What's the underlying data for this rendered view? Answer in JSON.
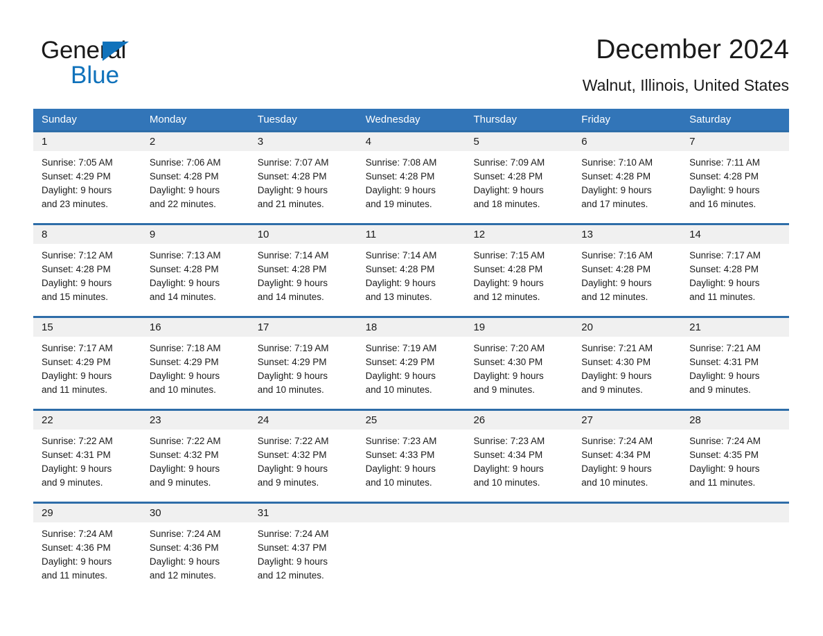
{
  "brand": {
    "name_part1": "General",
    "name_part2": "Blue",
    "triangle_color": "#1072bb",
    "text_color": "#1a1a1a"
  },
  "header": {
    "title": "December 2024",
    "subtitle": "Walnut, Illinois, United States"
  },
  "theme": {
    "header_blue": "#3275b8",
    "separator_blue": "#2e6da8",
    "daynum_band": "#f0f0f0",
    "text": "#1a1a1a",
    "header_text": "#ffffff"
  },
  "weekdays": [
    "Sunday",
    "Monday",
    "Tuesday",
    "Wednesday",
    "Thursday",
    "Friday",
    "Saturday"
  ],
  "weeks": [
    {
      "days": [
        {
          "num": "1",
          "sunrise": "Sunrise: 7:05 AM",
          "sunset": "Sunset: 4:29 PM",
          "daylight1": "Daylight: 9 hours",
          "daylight2": "and 23 minutes."
        },
        {
          "num": "2",
          "sunrise": "Sunrise: 7:06 AM",
          "sunset": "Sunset: 4:28 PM",
          "daylight1": "Daylight: 9 hours",
          "daylight2": "and 22 minutes."
        },
        {
          "num": "3",
          "sunrise": "Sunrise: 7:07 AM",
          "sunset": "Sunset: 4:28 PM",
          "daylight1": "Daylight: 9 hours",
          "daylight2": "and 21 minutes."
        },
        {
          "num": "4",
          "sunrise": "Sunrise: 7:08 AM",
          "sunset": "Sunset: 4:28 PM",
          "daylight1": "Daylight: 9 hours",
          "daylight2": "and 19 minutes."
        },
        {
          "num": "5",
          "sunrise": "Sunrise: 7:09 AM",
          "sunset": "Sunset: 4:28 PM",
          "daylight1": "Daylight: 9 hours",
          "daylight2": "and 18 minutes."
        },
        {
          "num": "6",
          "sunrise": "Sunrise: 7:10 AM",
          "sunset": "Sunset: 4:28 PM",
          "daylight1": "Daylight: 9 hours",
          "daylight2": "and 17 minutes."
        },
        {
          "num": "7",
          "sunrise": "Sunrise: 7:11 AM",
          "sunset": "Sunset: 4:28 PM",
          "daylight1": "Daylight: 9 hours",
          "daylight2": "and 16 minutes."
        }
      ]
    },
    {
      "days": [
        {
          "num": "8",
          "sunrise": "Sunrise: 7:12 AM",
          "sunset": "Sunset: 4:28 PM",
          "daylight1": "Daylight: 9 hours",
          "daylight2": "and 15 minutes."
        },
        {
          "num": "9",
          "sunrise": "Sunrise: 7:13 AM",
          "sunset": "Sunset: 4:28 PM",
          "daylight1": "Daylight: 9 hours",
          "daylight2": "and 14 minutes."
        },
        {
          "num": "10",
          "sunrise": "Sunrise: 7:14 AM",
          "sunset": "Sunset: 4:28 PM",
          "daylight1": "Daylight: 9 hours",
          "daylight2": "and 14 minutes."
        },
        {
          "num": "11",
          "sunrise": "Sunrise: 7:14 AM",
          "sunset": "Sunset: 4:28 PM",
          "daylight1": "Daylight: 9 hours",
          "daylight2": "and 13 minutes."
        },
        {
          "num": "12",
          "sunrise": "Sunrise: 7:15 AM",
          "sunset": "Sunset: 4:28 PM",
          "daylight1": "Daylight: 9 hours",
          "daylight2": "and 12 minutes."
        },
        {
          "num": "13",
          "sunrise": "Sunrise: 7:16 AM",
          "sunset": "Sunset: 4:28 PM",
          "daylight1": "Daylight: 9 hours",
          "daylight2": "and 12 minutes."
        },
        {
          "num": "14",
          "sunrise": "Sunrise: 7:17 AM",
          "sunset": "Sunset: 4:28 PM",
          "daylight1": "Daylight: 9 hours",
          "daylight2": "and 11 minutes."
        }
      ]
    },
    {
      "days": [
        {
          "num": "15",
          "sunrise": "Sunrise: 7:17 AM",
          "sunset": "Sunset: 4:29 PM",
          "daylight1": "Daylight: 9 hours",
          "daylight2": "and 11 minutes."
        },
        {
          "num": "16",
          "sunrise": "Sunrise: 7:18 AM",
          "sunset": "Sunset: 4:29 PM",
          "daylight1": "Daylight: 9 hours",
          "daylight2": "and 10 minutes."
        },
        {
          "num": "17",
          "sunrise": "Sunrise: 7:19 AM",
          "sunset": "Sunset: 4:29 PM",
          "daylight1": "Daylight: 9 hours",
          "daylight2": "and 10 minutes."
        },
        {
          "num": "18",
          "sunrise": "Sunrise: 7:19 AM",
          "sunset": "Sunset: 4:29 PM",
          "daylight1": "Daylight: 9 hours",
          "daylight2": "and 10 minutes."
        },
        {
          "num": "19",
          "sunrise": "Sunrise: 7:20 AM",
          "sunset": "Sunset: 4:30 PM",
          "daylight1": "Daylight: 9 hours",
          "daylight2": "and 9 minutes."
        },
        {
          "num": "20",
          "sunrise": "Sunrise: 7:21 AM",
          "sunset": "Sunset: 4:30 PM",
          "daylight1": "Daylight: 9 hours",
          "daylight2": "and 9 minutes."
        },
        {
          "num": "21",
          "sunrise": "Sunrise: 7:21 AM",
          "sunset": "Sunset: 4:31 PM",
          "daylight1": "Daylight: 9 hours",
          "daylight2": "and 9 minutes."
        }
      ]
    },
    {
      "days": [
        {
          "num": "22",
          "sunrise": "Sunrise: 7:22 AM",
          "sunset": "Sunset: 4:31 PM",
          "daylight1": "Daylight: 9 hours",
          "daylight2": "and 9 minutes."
        },
        {
          "num": "23",
          "sunrise": "Sunrise: 7:22 AM",
          "sunset": "Sunset: 4:32 PM",
          "daylight1": "Daylight: 9 hours",
          "daylight2": "and 9 minutes."
        },
        {
          "num": "24",
          "sunrise": "Sunrise: 7:22 AM",
          "sunset": "Sunset: 4:32 PM",
          "daylight1": "Daylight: 9 hours",
          "daylight2": "and 9 minutes."
        },
        {
          "num": "25",
          "sunrise": "Sunrise: 7:23 AM",
          "sunset": "Sunset: 4:33 PM",
          "daylight1": "Daylight: 9 hours",
          "daylight2": "and 10 minutes."
        },
        {
          "num": "26",
          "sunrise": "Sunrise: 7:23 AM",
          "sunset": "Sunset: 4:34 PM",
          "daylight1": "Daylight: 9 hours",
          "daylight2": "and 10 minutes."
        },
        {
          "num": "27",
          "sunrise": "Sunrise: 7:24 AM",
          "sunset": "Sunset: 4:34 PM",
          "daylight1": "Daylight: 9 hours",
          "daylight2": "and 10 minutes."
        },
        {
          "num": "28",
          "sunrise": "Sunrise: 7:24 AM",
          "sunset": "Sunset: 4:35 PM",
          "daylight1": "Daylight: 9 hours",
          "daylight2": "and 11 minutes."
        }
      ]
    },
    {
      "days": [
        {
          "num": "29",
          "sunrise": "Sunrise: 7:24 AM",
          "sunset": "Sunset: 4:36 PM",
          "daylight1": "Daylight: 9 hours",
          "daylight2": "and 11 minutes."
        },
        {
          "num": "30",
          "sunrise": "Sunrise: 7:24 AM",
          "sunset": "Sunset: 4:36 PM",
          "daylight1": "Daylight: 9 hours",
          "daylight2": "and 12 minutes."
        },
        {
          "num": "31",
          "sunrise": "Sunrise: 7:24 AM",
          "sunset": "Sunset: 4:37 PM",
          "daylight1": "Daylight: 9 hours",
          "daylight2": "and 12 minutes."
        },
        {
          "num": "",
          "sunrise": "",
          "sunset": "",
          "daylight1": "",
          "daylight2": ""
        },
        {
          "num": "",
          "sunrise": "",
          "sunset": "",
          "daylight1": "",
          "daylight2": ""
        },
        {
          "num": "",
          "sunrise": "",
          "sunset": "",
          "daylight1": "",
          "daylight2": ""
        },
        {
          "num": "",
          "sunrise": "",
          "sunset": "",
          "daylight1": "",
          "daylight2": ""
        }
      ]
    }
  ]
}
